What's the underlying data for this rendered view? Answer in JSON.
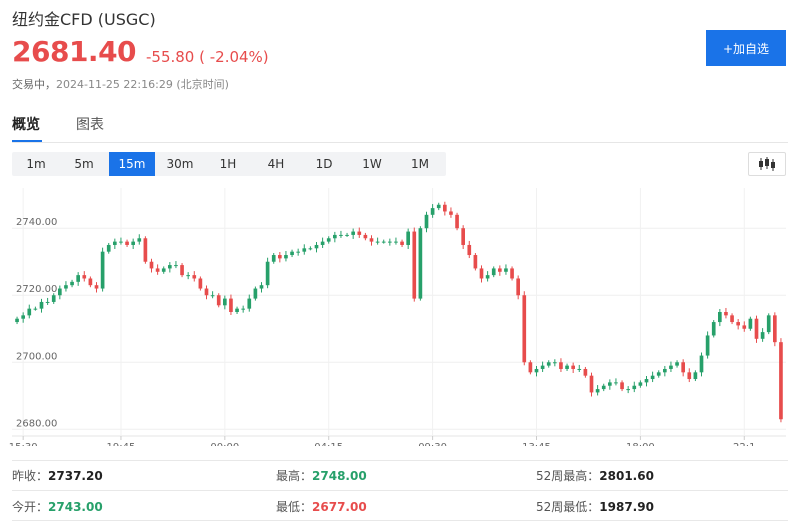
{
  "header": {
    "title": "纽约金CFD  (USGC)",
    "price": "2681.40",
    "change": "-55.80 ( -2.04%)",
    "status": "交易中，",
    "timestamp": "2024-11-25 22:16:29 (北京时间)",
    "add_button": "+加自选"
  },
  "tabs": [
    {
      "label": "概览"
    },
    {
      "label": "图表"
    }
  ],
  "intervals": [
    {
      "label": "1m"
    },
    {
      "label": "5m"
    },
    {
      "label": "15m"
    },
    {
      "label": "30m"
    },
    {
      "label": "1H"
    },
    {
      "label": "4H"
    },
    {
      "label": "1D"
    },
    {
      "label": "1W"
    },
    {
      "label": "1M"
    }
  ],
  "active_interval": "15m",
  "colors": {
    "up": "#27a06a",
    "down": "#e74c4c",
    "accent": "#1a73e8"
  },
  "chart_data": {
    "type": "candlestick",
    "y_ticks": [
      "2740.00",
      "2720.00",
      "2700.00",
      "2680.00"
    ],
    "y_values": [
      2740,
      2720,
      2700,
      2680
    ],
    "x_ticks": [
      "15:30",
      "19:45",
      "00:00",
      "04:15",
      "09:30",
      "13:45",
      "18:00",
      "22:1"
    ],
    "ylim": [
      2678,
      2752
    ],
    "closes": [
      2713,
      2714,
      2716,
      2716,
      2718,
      2718,
      2720,
      2722,
      2723,
      2724,
      2726,
      2725,
      2723,
      2722,
      2733,
      2735,
      2736,
      2736,
      2735,
      2736,
      2737,
      2730,
      2728,
      2727,
      2728,
      2729,
      2729,
      2726,
      2726,
      2725,
      2722,
      2720,
      2720,
      2717,
      2719,
      2715,
      2716,
      2716,
      2719,
      2722,
      2723,
      2730,
      2732,
      2731,
      2732,
      2733,
      2733,
      2734,
      2734,
      2735,
      2736,
      2737,
      2738,
      2738,
      2738,
      2739,
      2738,
      2737,
      2736,
      2736,
      2736,
      2736,
      2736,
      2735,
      2739,
      2719,
      2740,
      2744,
      2746,
      2747,
      2745,
      2744,
      2740,
      2735,
      2732,
      2728,
      2725,
      2726,
      2728,
      2727,
      2728,
      2725,
      2720,
      2700,
      2697,
      2698,
      2699,
      2700,
      2700,
      2698,
      2699,
      2698,
      2698,
      2696,
      2691,
      2692,
      2693,
      2694,
      2694,
      2692,
      2692,
      2693,
      2694,
      2695,
      2696,
      2697,
      2698,
      2699,
      2700,
      2697,
      2695,
      2697,
      2702,
      2708,
      2712,
      2715,
      2714,
      2712,
      2711,
      2710,
      2713,
      2707,
      2709,
      2714,
      2706,
      2683
    ]
  },
  "stats": {
    "prev_close_label": "昨收：",
    "prev_close": "2737.20",
    "high_label": "最高：",
    "high": "2748.00",
    "high52_label": "52周最高：",
    "high52": "2801.60",
    "open_label": "今开：",
    "open": "2743.00",
    "low_label": "最低：",
    "low": "2677.00",
    "low52_label": "52周最低：",
    "low52": "1987.90"
  }
}
